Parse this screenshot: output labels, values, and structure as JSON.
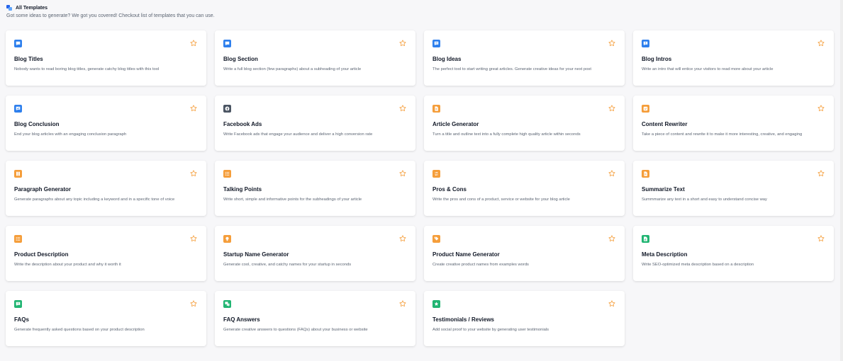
{
  "header": {
    "title": "All Templates",
    "subtitle": "Got some ideas to generate? We got you covered! Checkout list of templates that you can use."
  },
  "colors": {
    "blue": "#2f80ed",
    "blue_bg": "#dbeafe",
    "orange": "#f59e3b",
    "orange_bg": "#fdebd3",
    "green": "#22b573",
    "green_bg": "#d9f5e6",
    "gray": "#4b5563",
    "gray_bg": "#e5e7eb",
    "star": "#f59e3b"
  },
  "templates": [
    {
      "name": "blog-titles",
      "title": "Blog Titles",
      "description": "Nobody wants to read boring blog titles, generate catchy blog titles with this tool",
      "icon": "chat-bubble-icon",
      "color": "blue"
    },
    {
      "name": "blog-section",
      "title": "Blog Section",
      "description": "Write a full blog section (few paragraphs) about a subheading of your article",
      "icon": "chat-bubble-icon",
      "color": "blue"
    },
    {
      "name": "blog-ideas",
      "title": "Blog Ideas",
      "description": "The perfect tool to start writing great articles. Generate creative ideas for your next post",
      "icon": "chat-dots-icon",
      "color": "blue"
    },
    {
      "name": "blog-intros",
      "title": "Blog Intros",
      "description": "Write an intro that will entice your visitors to read more about your article",
      "icon": "chat-alert-icon",
      "color": "blue"
    },
    {
      "name": "blog-conclusion",
      "title": "Blog Conclusion",
      "description": "End your blog articles with an engaging conclusion paragraph",
      "icon": "chat-check-icon",
      "color": "blue"
    },
    {
      "name": "facebook-ads",
      "title": "Facebook Ads",
      "description": "Write Facebook ads that engage your audience and deliver a high conversion rate",
      "icon": "facebook-icon",
      "color": "gray"
    },
    {
      "name": "article-generator",
      "title": "Article Generator",
      "description": "Turn a title and outline text into a fully complete high quality article within seconds",
      "icon": "document-icon",
      "color": "orange"
    },
    {
      "name": "content-rewriter",
      "title": "Content Rewriter",
      "description": "Take a piece of content and rewrite it to make it more interesting, creative, and engaging",
      "icon": "check-square-icon",
      "color": "orange"
    },
    {
      "name": "paragraph-generator",
      "title": "Paragraph Generator",
      "description": "Generate paragraphs about any topic including a keyword and in a specific tone of voice",
      "icon": "columns-icon",
      "color": "orange"
    },
    {
      "name": "talking-points",
      "title": "Talking Points",
      "description": "Write short, simple and informative points for the subheadings of your article",
      "icon": "list-icon",
      "color": "orange"
    },
    {
      "name": "pros-cons",
      "title": "Pros & Cons",
      "description": "Write the pros and cons of a product, service or website for your blog article",
      "icon": "swap-icon",
      "color": "orange"
    },
    {
      "name": "summarize-text",
      "title": "Summarize Text",
      "description": "Summmarize any text in a short and easy to understand concise way",
      "icon": "document-icon",
      "color": "orange"
    },
    {
      "name": "product-description",
      "title": "Product Description",
      "description": "Write the description about your product and why it worth it",
      "icon": "list-icon",
      "color": "orange"
    },
    {
      "name": "startup-name-generator",
      "title": "Startup Name Generator",
      "description": "Generate cool, creative, and catchy names for your startup in seconds",
      "icon": "lightbulb-icon",
      "color": "orange"
    },
    {
      "name": "product-name-generator",
      "title": "Product Name Generator",
      "description": "Create creative product names from examples words",
      "icon": "tag-icon",
      "color": "orange"
    },
    {
      "name": "meta-description",
      "title": "Meta Description",
      "description": "Write SEO-optimized meta description based on a description",
      "icon": "document-chart-icon",
      "color": "green"
    },
    {
      "name": "faqs",
      "title": "FAQs",
      "description": "Generate frequently asked questions based on your product description",
      "icon": "chat-alert-icon",
      "color": "green"
    },
    {
      "name": "faq-answers",
      "title": "FAQ Answers",
      "description": "Generate creative answers to questions (FAQs) about your business or website",
      "icon": "chat-double-icon",
      "color": "green"
    },
    {
      "name": "testimonials-reviews",
      "title": "Testimonials / Reviews",
      "description": "Add social proof to your website by generating user testimonials",
      "icon": "star-badge-icon",
      "color": "green"
    }
  ]
}
